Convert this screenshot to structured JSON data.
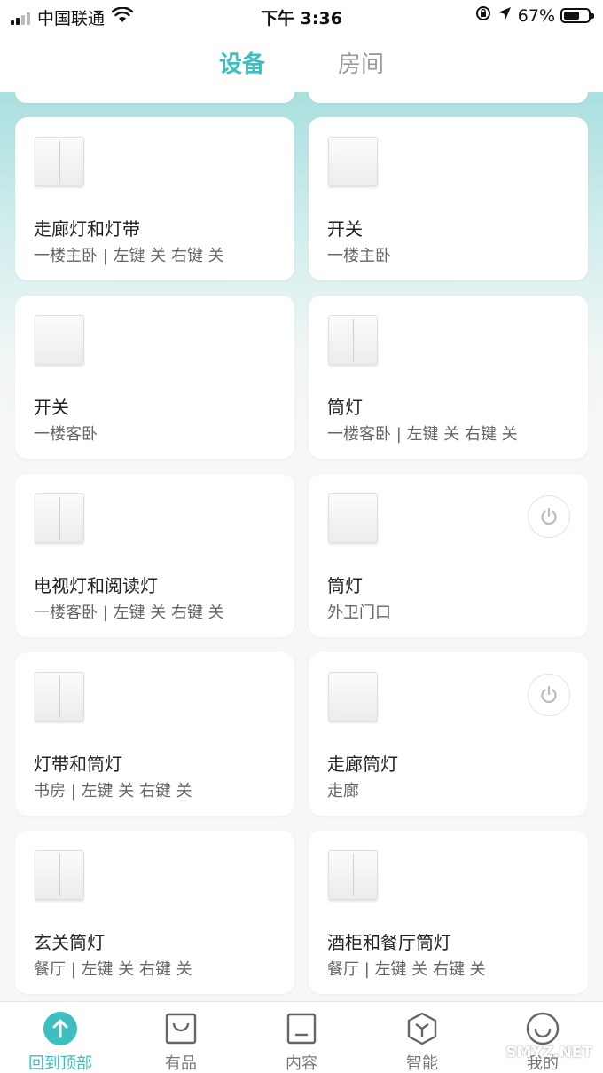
{
  "status_bar": {
    "carrier": "中国联通",
    "time": "下午 3:36",
    "battery": "67%",
    "battery_level": 0.67
  },
  "header": {
    "tabs": [
      {
        "label": "设备",
        "active": true
      },
      {
        "label": "房间",
        "active": false
      }
    ]
  },
  "devices": [
    {
      "name": "走廊灯和灯带",
      "subtitle": "一楼主卧 | 左键 关 右键 关",
      "switch": "double",
      "power_icon": false
    },
    {
      "name": "开关",
      "subtitle": "一楼主卧",
      "switch": "single",
      "power_icon": false
    },
    {
      "name": "开关",
      "subtitle": "一楼客卧",
      "switch": "single",
      "power_icon": false
    },
    {
      "name": "筒灯",
      "subtitle": "一楼客卧 | 左键 关 右键 关",
      "switch": "double",
      "power_icon": false
    },
    {
      "name": "电视灯和阅读灯",
      "subtitle": "一楼客卧 | 左键 关 右键 关",
      "switch": "double",
      "power_icon": false
    },
    {
      "name": "筒灯",
      "subtitle": "外卫门口",
      "switch": "single",
      "power_icon": true
    },
    {
      "name": "灯带和筒灯",
      "subtitle": "书房 | 左键 关 右键 关",
      "switch": "double",
      "power_icon": false
    },
    {
      "name": "走廊筒灯",
      "subtitle": "走廊",
      "switch": "single",
      "power_icon": true
    },
    {
      "name": "玄关筒灯",
      "subtitle": "餐厅 | 左键 关 右键 关",
      "switch": "double",
      "power_icon": false
    },
    {
      "name": "酒柜和餐厅筒灯",
      "subtitle": "餐厅 | 左键 关 右键 关",
      "switch": "double",
      "power_icon": false
    }
  ],
  "bottom_nav": [
    {
      "label": "回到顶部",
      "icon": "arrow-up-circle-icon",
      "active": true
    },
    {
      "label": "有品",
      "icon": "shopping-bag-icon",
      "active": false
    },
    {
      "label": "内容",
      "icon": "content-icon",
      "active": false
    },
    {
      "label": "智能",
      "icon": "cube-icon",
      "active": false
    },
    {
      "label": "我的",
      "icon": "smile-icon",
      "active": false
    }
  ],
  "watermark": "SMYZ.NET",
  "colors": {
    "accent": "#3cbfbf",
    "background": "#f6f7f7",
    "card": "#ffffff"
  }
}
